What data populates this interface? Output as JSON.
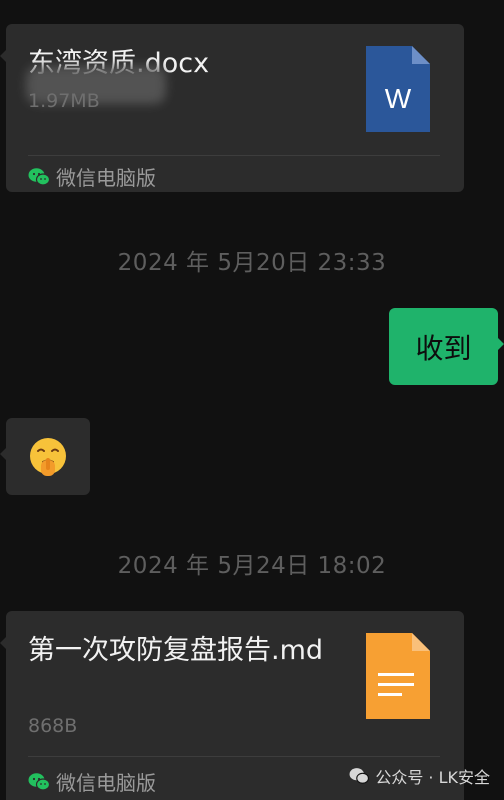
{
  "messages": {
    "file1": {
      "name": "东湾资质.docx",
      "size": "1.97MB",
      "source": "微信电脑版",
      "file_icon_letter": "W",
      "icon": "word-doc-icon"
    },
    "timestamp1": "2024 年 5月20日 23:33",
    "sent_text": "收到",
    "emoji_icon": "shush-emoji-icon",
    "timestamp2": "2024 年 5月24日 18:02",
    "file2": {
      "name": "第一次攻防复盘报告.md",
      "size": "868B",
      "source": "微信电脑版",
      "icon": "text-doc-icon"
    }
  },
  "watermark": {
    "text": "公众号 · LK安全",
    "icon": "wechat-icon"
  },
  "colors": {
    "background": "#111111",
    "card": "#2c2c2c",
    "sent_bubble": "#1fb36b",
    "word_blue": "#2b579a",
    "doc_orange": "#f7a033"
  }
}
